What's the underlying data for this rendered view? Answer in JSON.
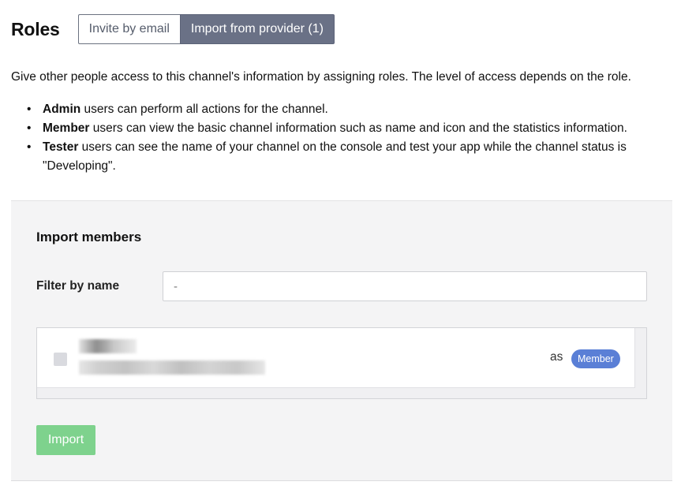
{
  "header": {
    "title": "Roles",
    "tabs": [
      {
        "label": "Invite by email",
        "active": false
      },
      {
        "label": "Import from provider (1)",
        "active": true
      }
    ]
  },
  "description": "Give other people access to this channel's information by assigning roles. The level of access depends on the role.",
  "roles_info": [
    {
      "role": "Admin",
      "text": " users can perform all actions for the channel."
    },
    {
      "role": "Member",
      "text": " users can view the basic channel information such as name and icon and the statistics information."
    },
    {
      "role": "Tester",
      "text": " users can see the name of your channel on the console and test your app while the channel status is \"Developing\"."
    }
  ],
  "import_panel": {
    "title": "Import members",
    "filter_label": "Filter by name",
    "filter_value": "-",
    "members": [
      {
        "as_text": "as",
        "role": "Member",
        "checked": false
      }
    ],
    "import_button": "Import"
  },
  "colors": {
    "active_tab": "#6a7186",
    "role_badge": "#5a7fd6",
    "import_button": "#7ed28d",
    "panel_background": "#f4f4f5"
  }
}
